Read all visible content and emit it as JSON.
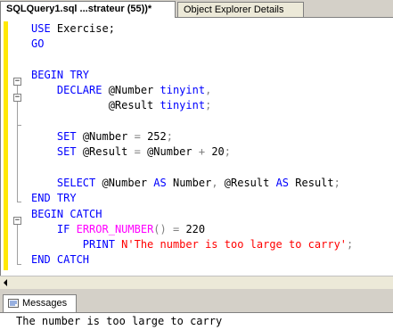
{
  "tabs": {
    "active_label": "SQLQuery1.sql ...strateur (55))*",
    "inactive_label": "Object Explorer Details",
    "close_glyph": "×"
  },
  "editor": {
    "lines": [
      [
        {
          "t": "USE ",
          "c": "kw"
        },
        {
          "t": "Exercise;",
          "c": "plain"
        }
      ],
      [
        {
          "t": "GO",
          "c": "kw"
        }
      ],
      [],
      [
        {
          "t": "BEGIN TRY",
          "c": "kw"
        }
      ],
      [
        {
          "t": "    ",
          "c": "plain"
        },
        {
          "t": "DECLARE ",
          "c": "kw"
        },
        {
          "t": "@Number ",
          "c": "var"
        },
        {
          "t": "tinyint",
          "c": "kw"
        },
        {
          "t": ",",
          "c": "op"
        }
      ],
      [
        {
          "t": "            ",
          "c": "plain"
        },
        {
          "t": "@Result ",
          "c": "var"
        },
        {
          "t": "tinyint",
          "c": "kw"
        },
        {
          "t": ";",
          "c": "op"
        }
      ],
      [],
      [
        {
          "t": "    ",
          "c": "plain"
        },
        {
          "t": "SET ",
          "c": "kw"
        },
        {
          "t": "@Number ",
          "c": "var"
        },
        {
          "t": "= ",
          "c": "op"
        },
        {
          "t": "252",
          "c": "plain"
        },
        {
          "t": ";",
          "c": "op"
        }
      ],
      [
        {
          "t": "    ",
          "c": "plain"
        },
        {
          "t": "SET ",
          "c": "kw"
        },
        {
          "t": "@Result ",
          "c": "var"
        },
        {
          "t": "= ",
          "c": "op"
        },
        {
          "t": "@Number ",
          "c": "var"
        },
        {
          "t": "+ ",
          "c": "op"
        },
        {
          "t": "20",
          "c": "plain"
        },
        {
          "t": ";",
          "c": "op"
        }
      ],
      [],
      [
        {
          "t": "    ",
          "c": "plain"
        },
        {
          "t": "SELECT ",
          "c": "kw"
        },
        {
          "t": "@Number ",
          "c": "var"
        },
        {
          "t": "AS ",
          "c": "kw"
        },
        {
          "t": "Number",
          "c": "plain"
        },
        {
          "t": ", ",
          "c": "op"
        },
        {
          "t": "@Result ",
          "c": "var"
        },
        {
          "t": "AS ",
          "c": "kw"
        },
        {
          "t": "Result",
          "c": "plain"
        },
        {
          "t": ";",
          "c": "op"
        }
      ],
      [
        {
          "t": "END TRY",
          "c": "kw"
        }
      ],
      [
        {
          "t": "BEGIN CATCH",
          "c": "kw"
        }
      ],
      [
        {
          "t": "    ",
          "c": "plain"
        },
        {
          "t": "IF ",
          "c": "kw"
        },
        {
          "t": "ERROR_NUMBER",
          "c": "fn"
        },
        {
          "t": "() ",
          "c": "op"
        },
        {
          "t": "= ",
          "c": "op"
        },
        {
          "t": "220",
          "c": "plain"
        }
      ],
      [
        {
          "t": "        ",
          "c": "plain"
        },
        {
          "t": "PRINT ",
          "c": "kw"
        },
        {
          "t": "N'The number is too large to carry'",
          "c": "str"
        },
        {
          "t": ";",
          "c": "op"
        }
      ],
      [
        {
          "t": "END CATCH",
          "c": "kw"
        }
      ]
    ]
  },
  "results": {
    "tab_label": "Messages",
    "message": "The number is too large to carry"
  },
  "colors": {
    "keyword": "#0000ff",
    "string": "#ff0000",
    "function": "#ff00ff",
    "change_margin": "#ffe800"
  }
}
